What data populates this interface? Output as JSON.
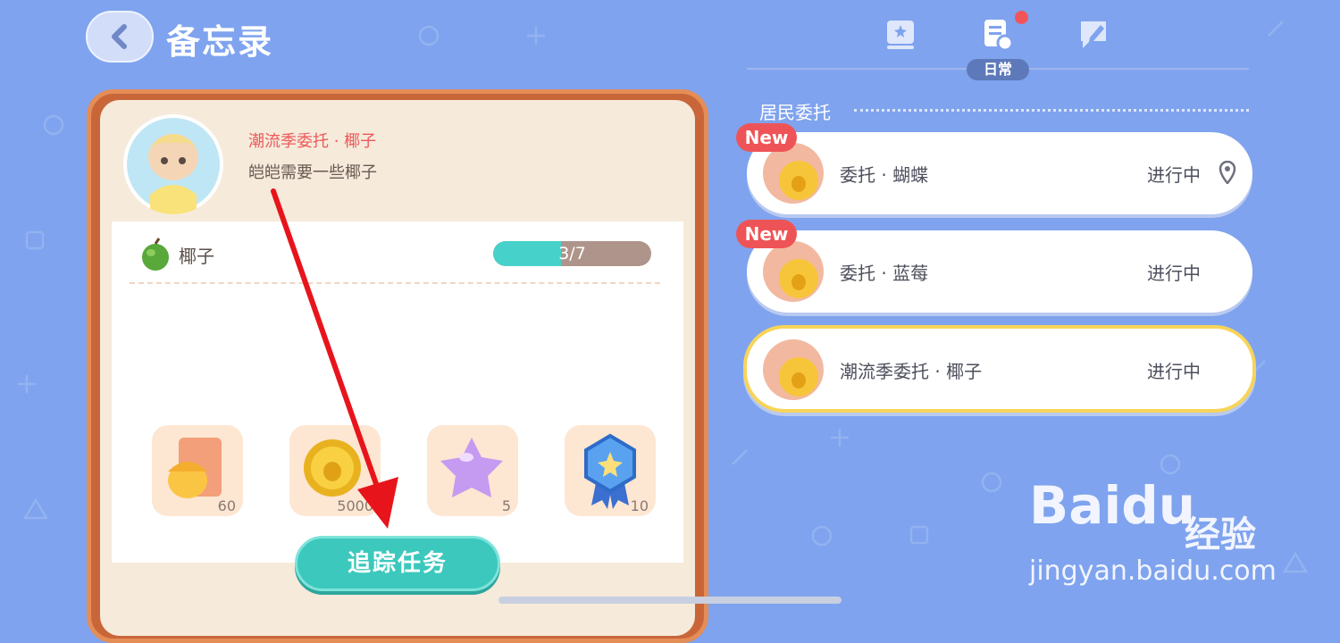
{
  "header": {
    "title": "备忘录",
    "back_icon": "chevron-left-icon"
  },
  "tabs": {
    "icons": [
      "book-icon",
      "clipboard-refresh-icon",
      "note-pen-icon"
    ],
    "active_label": "日常"
  },
  "section": {
    "label": "居民委托"
  },
  "detail": {
    "title": "潮流季委托 · 椰子",
    "description": "皑皑需要一些椰子",
    "item": {
      "name": "椰子",
      "progress_text": "3/7",
      "progress_fraction": 0.43
    },
    "rewards": [
      {
        "icon": "acorn-card-icon",
        "count": "60"
      },
      {
        "icon": "coin-icon",
        "count": "5000"
      },
      {
        "icon": "star-icon",
        "count": "5"
      },
      {
        "icon": "medal-icon",
        "count": "10"
      }
    ],
    "track_button": "追踪任务"
  },
  "quests": [
    {
      "badge": "New",
      "name": "委托 · 蝴蝶",
      "status": "进行中",
      "has_pin": true
    },
    {
      "badge": "New",
      "name": "委托 · 蓝莓",
      "status": "进行中",
      "has_pin": false
    },
    {
      "badge": "",
      "name": "潮流季委托 · 椰子",
      "status": "进行中",
      "has_pin": false
    }
  ],
  "watermark": {
    "logo": "Baidu",
    "cn": "经验",
    "url": "jingyan.baidu.com"
  },
  "colors": {
    "background": "#7fa3ee",
    "accent": "#3cc8bd",
    "new_badge": "#ee5457",
    "frame": "#c8663a"
  }
}
